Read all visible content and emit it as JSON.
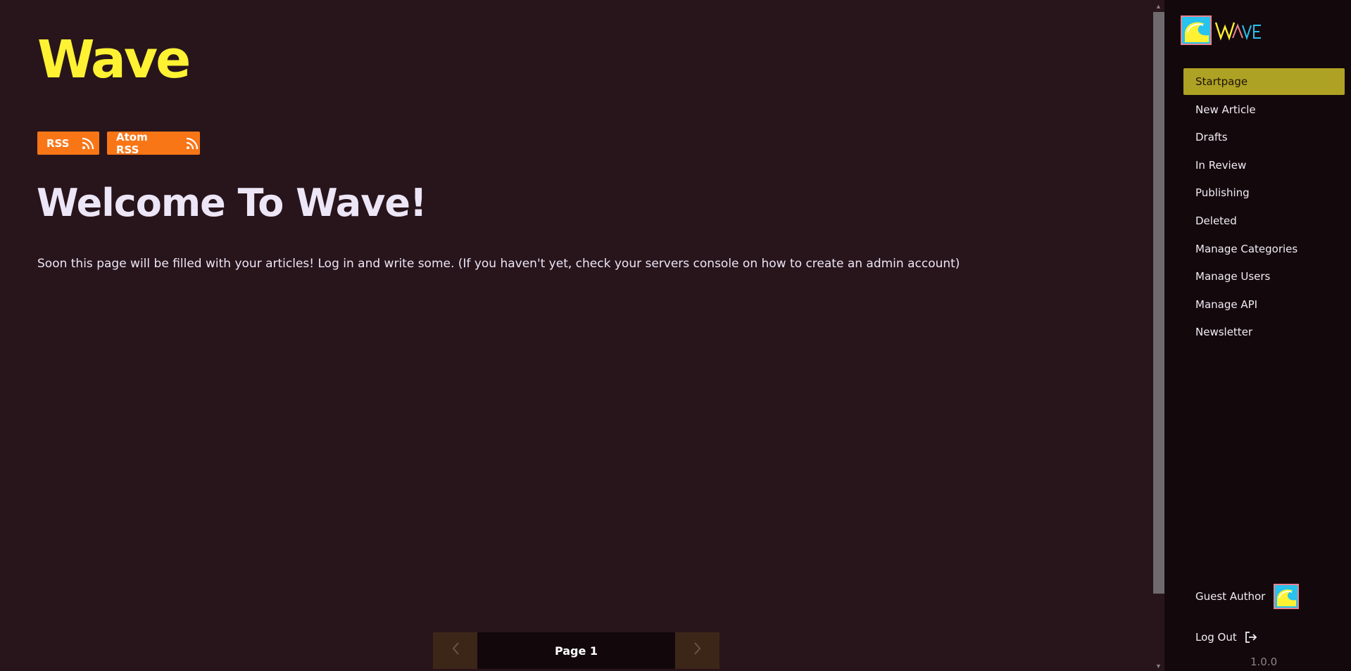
{
  "site": {
    "title": "Wave"
  },
  "feeds": {
    "rss_label": "RSS",
    "atom_label": "Atom RSS"
  },
  "content": {
    "heading": "Welcome To Wave!",
    "intro": "Soon this page will be filled with your articles! Log in and write some. (If you haven't yet, check your servers console on how to create an admin account)"
  },
  "pagination": {
    "prev_icon": "chevron-left-icon",
    "next_icon": "chevron-right-icon",
    "page_label": "Page 1"
  },
  "sidebar": {
    "logo_text": "WAVE",
    "items": [
      {
        "label": "Startpage",
        "active": true
      },
      {
        "label": "New Article"
      },
      {
        "label": "Drafts"
      },
      {
        "label": "In Review"
      },
      {
        "label": "Publishing"
      },
      {
        "label": "Deleted"
      },
      {
        "label": "Manage Categories"
      },
      {
        "label": "Manage Users"
      },
      {
        "label": "Manage API"
      },
      {
        "label": "Newsletter"
      }
    ],
    "author": "Guest Author",
    "logout_label": "Log Out",
    "version": "1.0.0"
  },
  "colors": {
    "background": "#28151b",
    "sidebar": "#13090d",
    "title_yellow": "#fef233",
    "feed_orange": "#f97617",
    "active_item": "#aea224"
  }
}
